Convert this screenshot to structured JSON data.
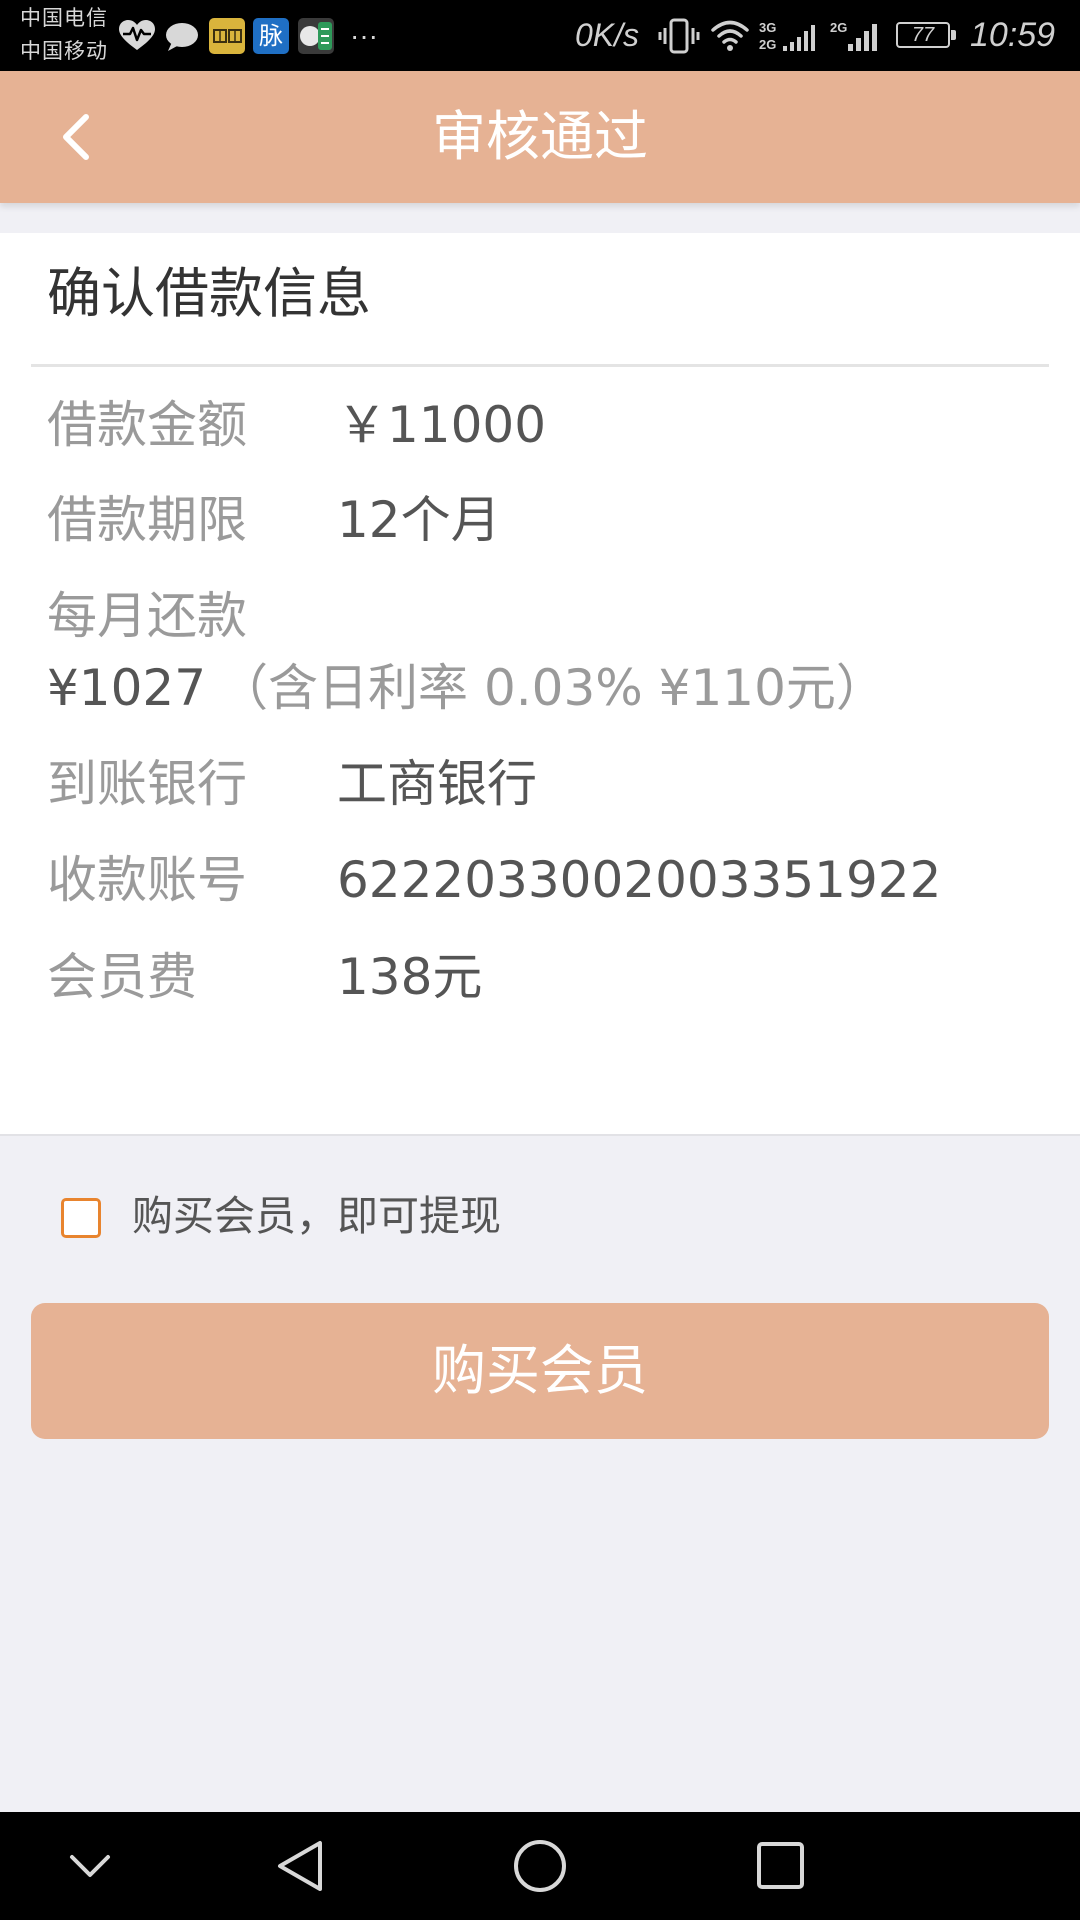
{
  "status_bar": {
    "carriers": [
      "中国电信",
      "中国移动"
    ],
    "notification_icons": [
      "heart-rate-icon",
      "chat-bubble-icon",
      "app-icon-yellow",
      "app-icon-mai",
      "app-icon-green"
    ],
    "mai_logo_text": "脉",
    "more": "···",
    "net_speed": "0K/s",
    "sim1_types": [
      "3G",
      "2G"
    ],
    "sim2_type": "2G",
    "battery": "77",
    "time": "10:59",
    "right_icons": [
      "vibrate-icon",
      "wifi-icon",
      "signal-icon",
      "signal-icon",
      "battery-icon"
    ]
  },
  "header": {
    "title": "审核通过",
    "back_icon": "chevron-left-icon"
  },
  "loan_info": {
    "title": "确认借款信息",
    "amount": {
      "label": "借款金额",
      "value": "￥11000"
    },
    "term": {
      "label": "借款期限",
      "value": "12个月"
    },
    "monthly": {
      "label": "每月还款",
      "value": "¥1027",
      "note": "（含日利率 0.03% ¥110元）"
    },
    "bank": {
      "label": "到账银行",
      "value": "工商银行"
    },
    "account": {
      "label": "收款账号",
      "value": "6222033002003351922"
    },
    "fee": {
      "label": "会员费",
      "value": "138元"
    }
  },
  "agreement": {
    "checked": false,
    "label": "购买会员，即可提现"
  },
  "buy_button": {
    "label": "购买会员"
  },
  "nav_bar": {
    "icons": [
      "chevron-down-icon",
      "back-triangle-icon",
      "home-circle-icon",
      "recents-square-icon"
    ]
  },
  "colors": {
    "header_bg": "#E6B294",
    "button_bg": "#E6B294",
    "checkbox_border": "#E8842E",
    "page_bg": "#F0F0F5",
    "label_text": "#9A9A9A",
    "value_text": "#555555"
  }
}
